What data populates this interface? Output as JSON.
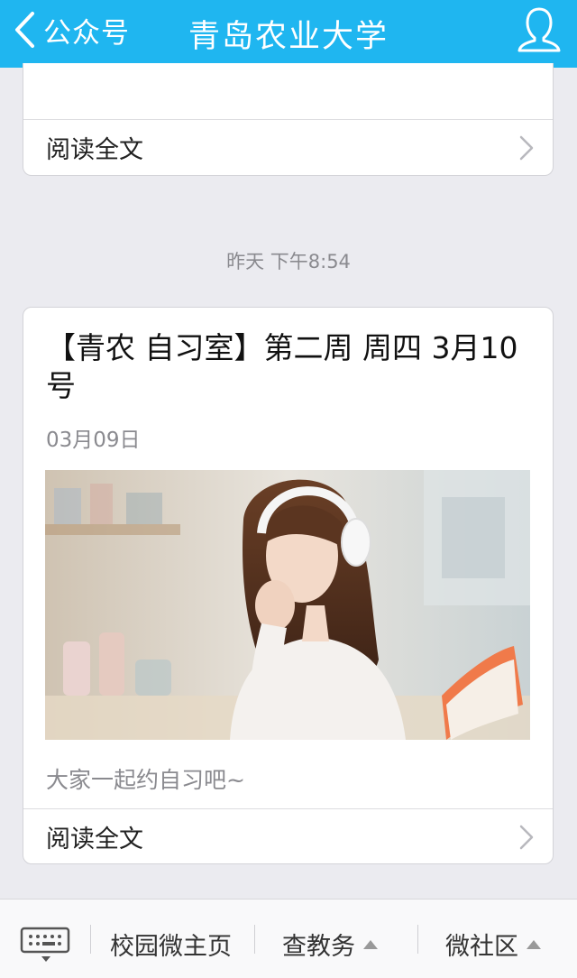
{
  "header": {
    "back_label": "公众号",
    "title": "青岛农业大学"
  },
  "previous_article": {
    "read_more": "阅读全文"
  },
  "timestamp": "昨天 下午8:54",
  "article": {
    "title": "【青农 自习室】第二周 周四 3月10号",
    "date": "03月09日",
    "summary": "大家一起约自习吧~",
    "read_more": "阅读全文"
  },
  "bottom_menu": {
    "items": [
      {
        "label": "校园微主页"
      },
      {
        "label": "查教务"
      },
      {
        "label": "微社区"
      }
    ]
  },
  "colors": {
    "accent": "#1fb6f0",
    "background": "#ebebf0"
  }
}
